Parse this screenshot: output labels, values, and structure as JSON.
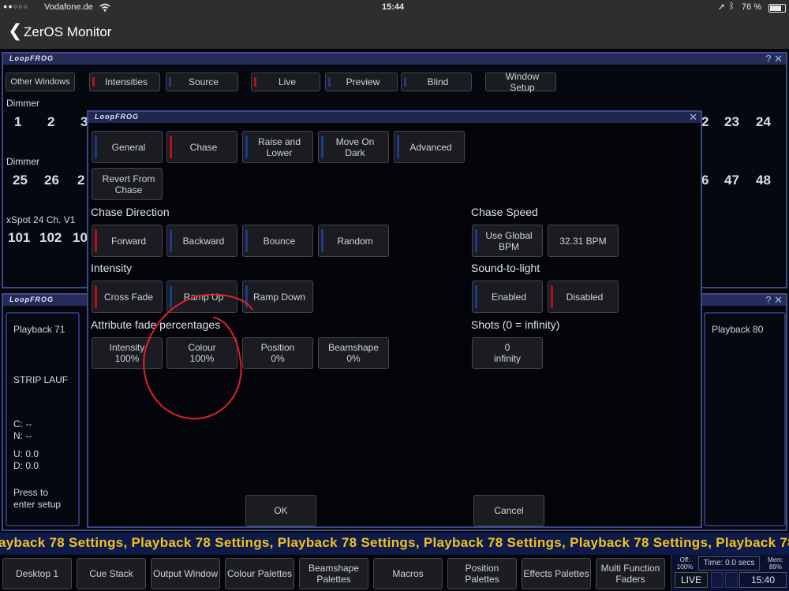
{
  "status": {
    "carrier": "Vodafone.de",
    "time": "15:44",
    "battery": "76 %"
  },
  "nav": {
    "title": "ZerOS Monitor"
  },
  "logo": "LoopFROG",
  "main": {
    "buttons": [
      "Other Windows",
      "Intensities",
      "Source",
      "Live",
      "Preview",
      "Blind",
      "Window Setup"
    ],
    "dimmer1_label": "Dimmer",
    "dimmer1_left": [
      "1",
      "2",
      "3"
    ],
    "dimmer1_right": [
      "2",
      "23",
      "24"
    ],
    "dimmer2_label": "Dimmer",
    "dimmer2_left": [
      "25",
      "26",
      "2"
    ],
    "dimmer2_right": [
      "6",
      "47",
      "48"
    ],
    "xspot_label": "xSpot 24 Ch. V1",
    "xspot_nums": [
      "101",
      "102",
      "10"
    ]
  },
  "playback": {
    "left_title": "Playback 71",
    "left_name": "STRIP LAUF",
    "c": "C: --",
    "n": "N: --",
    "u": "U: 0.0",
    "d": "D: 0.0",
    "press1": "Press to",
    "press2": "enter setup",
    "right_title": "Playback 80"
  },
  "dialog": {
    "tabs": [
      "General",
      "Chase",
      "Raise and Lower",
      "Move On Dark",
      "Advanced"
    ],
    "revert": "Revert From Chase",
    "chase_direction": {
      "title": "Chase Direction",
      "options": [
        "Forward",
        "Backward",
        "Bounce",
        "Random"
      ]
    },
    "intensity": {
      "title": "Intensity",
      "options": [
        "Cross Fade",
        "Ramp Up",
        "Ramp Down"
      ]
    },
    "attr": {
      "title": "Attribute fade percentages",
      "items": [
        {
          "name": "Intensity",
          "value": "100%"
        },
        {
          "name": "Colour",
          "value": "100%"
        },
        {
          "name": "Position",
          "value": "0%"
        },
        {
          "name": "Beamshape",
          "value": "0%"
        }
      ]
    },
    "chase_speed": {
      "title": "Chase Speed",
      "global": "Use Global BPM",
      "bpm": "32.31 BPM"
    },
    "sound": {
      "title": "Sound-to-light",
      "enabled": "Enabled",
      "disabled": "Disabled"
    },
    "shots": {
      "title": "Shots (0 = infinity)",
      "value": "0",
      "unit": "infinity"
    },
    "ok": "OK",
    "cancel": "Cancel"
  },
  "ticker": "ayback 78 Settings, Playback 78 Settings, Playback 78 Settings, Playback 78 Settings, Playback 78 Settings, Playback 78 Settings,",
  "footer": {
    "buttons": [
      "Desktop 1",
      "Cue Stack",
      "Output Window",
      "Colour Palettes",
      "Beamshape Palettes",
      "Macros",
      "Position Palettes",
      "Effects Palettes",
      "Multi Function Faders"
    ],
    "off_label": "Off:",
    "off_value": "100%",
    "time_label": "Time: 0.0 secs",
    "mem_label": "Mem:",
    "mem_value": "89%",
    "live": "LIVE",
    "clock": "15:40"
  },
  "colors": {
    "accent_red": "#b3121c",
    "accent_blue": "#1d3a8a",
    "ticker_text": "#f2c21a",
    "annotation": "#e0202a"
  }
}
